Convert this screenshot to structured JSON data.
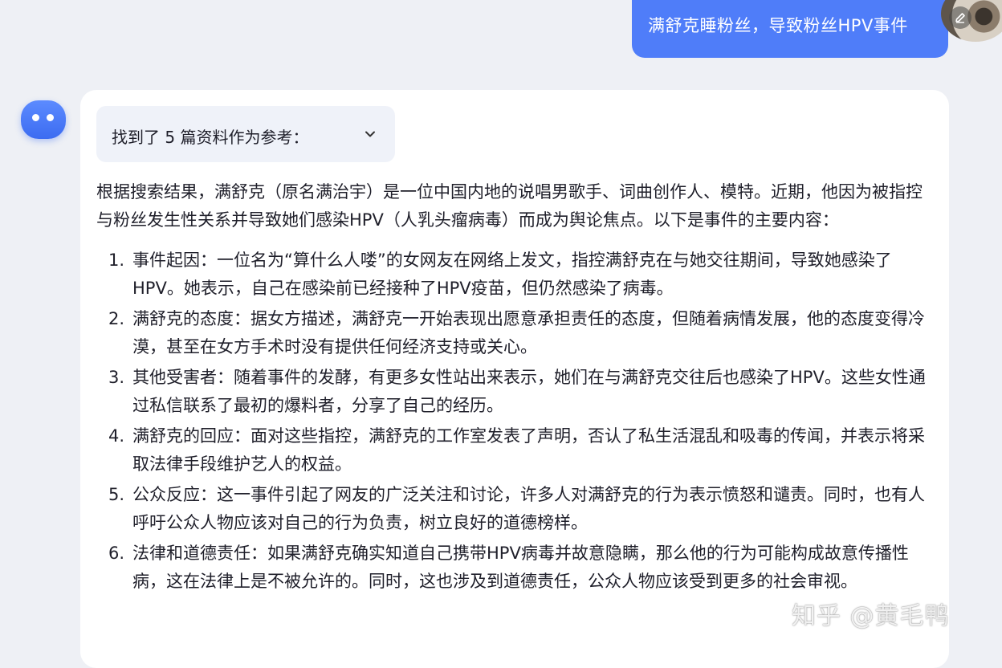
{
  "user_message": "满舒克睡粉丝，导致粉丝HPV事件",
  "references": {
    "label": "找到了 5 篇资料作为参考："
  },
  "answer": {
    "intro": "根据搜索结果，满舒克（原名满治宇）是一位中国内地的说唱男歌手、词曲创作人、模特。近期，他因为被指控与粉丝发生性关系并导致她们感染HPV（人乳头瘤病毒）而成为舆论焦点。以下是事件的主要内容：",
    "points": [
      {
        "num": "1.",
        "text": "事件起因：一位名为“算什么人喽”的女网友在网络上发文，指控满舒克在与她交往期间，导致她感染了HPV。她表示，自己在感染前已经接种了HPV疫苗，但仍然感染了病毒。"
      },
      {
        "num": "2.",
        "text": "满舒克的态度：据女方描述，满舒克一开始表现出愿意承担责任的态度，但随着病情发展，他的态度变得冷漠，甚至在女方手术时没有提供任何经济支持或关心。"
      },
      {
        "num": "3.",
        "text": "其他受害者：随着事件的发酵，有更多女性站出来表示，她们在与满舒克交往后也感染了HPV。这些女性通过私信联系了最初的爆料者，分享了自己的经历。"
      },
      {
        "num": "4.",
        "text": "满舒克的回应：面对这些指控，满舒克的工作室发表了声明，否认了私生活混乱和吸毒的传闻，并表示将采取法律手段维护艺人的权益。"
      },
      {
        "num": "5.",
        "text": "公众反应：这一事件引起了网友的广泛关注和讨论，许多人对满舒克的行为表示愤怒和谴责。同时，也有人呼吁公众人物应该对自己的行为负责，树立良好的道德榜样。"
      },
      {
        "num": "6.",
        "text": "法律和道德责任：如果满舒克确实知道自己携带HPV病毒并故意隐瞒，那么他的行为可能构成故意传播性病，这在法律上是不被允许的。同时，这也涉及到道德责任，公众人物应该受到更多的社会审视。"
      }
    ]
  },
  "watermark": "知乎 @黄毛鸭",
  "icons": {
    "edit": "edit-icon",
    "references_toggle": "chevron-down-icon",
    "assistant": "assistant-avatar-icon"
  },
  "colors": {
    "user_bubble": "#4f7df9",
    "assistant_avatar": "#3c6cf1",
    "page_background": "#eef0f5",
    "card_background": "#ffffff",
    "references_background": "#eff2f9"
  }
}
